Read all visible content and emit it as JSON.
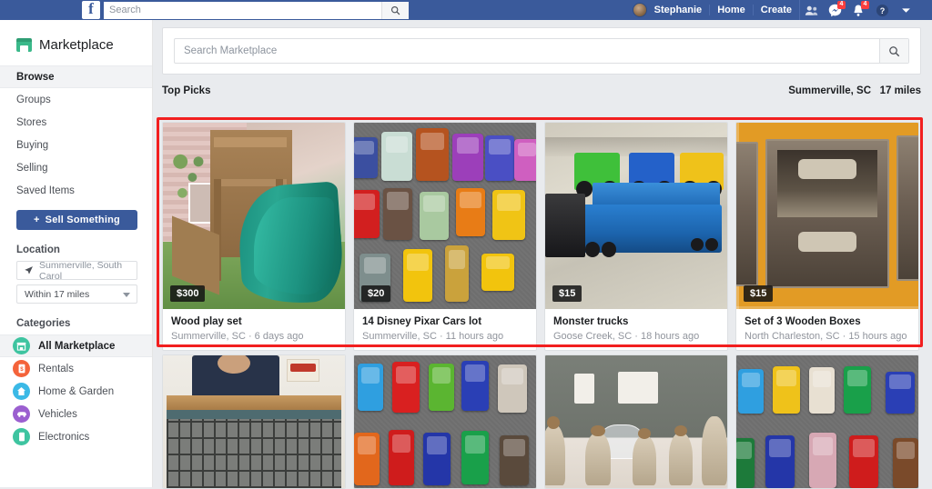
{
  "topbar": {
    "logo": "f",
    "search_placeholder": "Search",
    "search_icon": "search-icon",
    "user_name": "Stephanie",
    "home_label": "Home",
    "create_label": "Create",
    "friends_icon": "friends-icon",
    "messenger_icon": "messenger-icon",
    "messenger_badge": "4",
    "notifications_icon": "bell-icon",
    "notifications_badge": "4",
    "help_icon": "help-icon",
    "account_menu_icon": "chevron-down-icon",
    "background_color": "#3a5a9b"
  },
  "sidebar": {
    "marketplace_title": "Marketplace",
    "marketplace_icon": "storefront-icon",
    "nav_items": [
      {
        "label": "Browse",
        "active": true
      },
      {
        "label": "Groups",
        "active": false
      },
      {
        "label": "Stores",
        "active": false
      },
      {
        "label": "Buying",
        "active": false
      },
      {
        "label": "Selling",
        "active": false
      },
      {
        "label": "Saved Items",
        "active": false
      }
    ],
    "sell_button": {
      "label": "Sell Something",
      "plus": "+",
      "color": "#3a5a9b"
    },
    "location_heading": "Location",
    "location_value": "Summerville, South Carol",
    "location_icon": "navigation-arrow-icon",
    "radius_value": "Within 17 miles",
    "categories_heading": "Categories",
    "categories": [
      {
        "label": "All Marketplace",
        "icon": "storefront-icon",
        "color": "#3ec4a0",
        "active": true
      },
      {
        "label": "Rentals",
        "icon": "rental-tag-icon",
        "color": "#f4633a",
        "active": false
      },
      {
        "label": "Home & Garden",
        "icon": "home-icon",
        "color": "#3bb9e6",
        "active": false
      },
      {
        "label": "Vehicles",
        "icon": "car-icon",
        "color": "#9b5fd0",
        "active": false
      },
      {
        "label": "Electronics",
        "icon": "phone-icon",
        "color": "#3ec4a0",
        "active": false
      }
    ]
  },
  "main": {
    "search_placeholder": "Search Marketplace",
    "search_icon": "search-icon",
    "picks_title": "Top Picks",
    "picks_location": "Summerville, SC",
    "picks_radius": "17 miles",
    "highlight_color": "#f21f1f",
    "listings": [
      {
        "title": "Wood play set",
        "price": "$300",
        "location": "Summerville, SC",
        "time": "6 days ago",
        "meta": "Summerville, SC · 6 days ago",
        "image": "wooden-playset-with-teal-slide"
      },
      {
        "title": "14 Disney Pixar Cars lot",
        "price": "$20",
        "location": "Summerville, SC",
        "time": "11 hours ago",
        "meta": "Summerville, SC · 11 hours ago",
        "image": "toy-cars-on-gray-carpet"
      },
      {
        "title": "Monster trucks",
        "price": "$15",
        "location": "Goose Creek, SC",
        "time": "18 hours ago",
        "meta": "Goose Creek, SC · 18 hours ago",
        "image": "blue-car-hauler-with-monster-trucks"
      },
      {
        "title": "Set of 3 Wooden Boxes",
        "price": "$15",
        "location": "North Charleston, SC",
        "time": "15 hours ago",
        "meta": "North Charleston, SC · 15 hours ago",
        "image": "dark-wooden-crates-on-orange-cloth"
      }
    ],
    "second_row": [
      {
        "image": "wire-baskets-under-wooden-table"
      },
      {
        "image": "disney-cars-toys-row"
      },
      {
        "image": "willow-tree-figurines-on-counter"
      },
      {
        "image": "disney-cars-toys-row-two"
      }
    ]
  }
}
